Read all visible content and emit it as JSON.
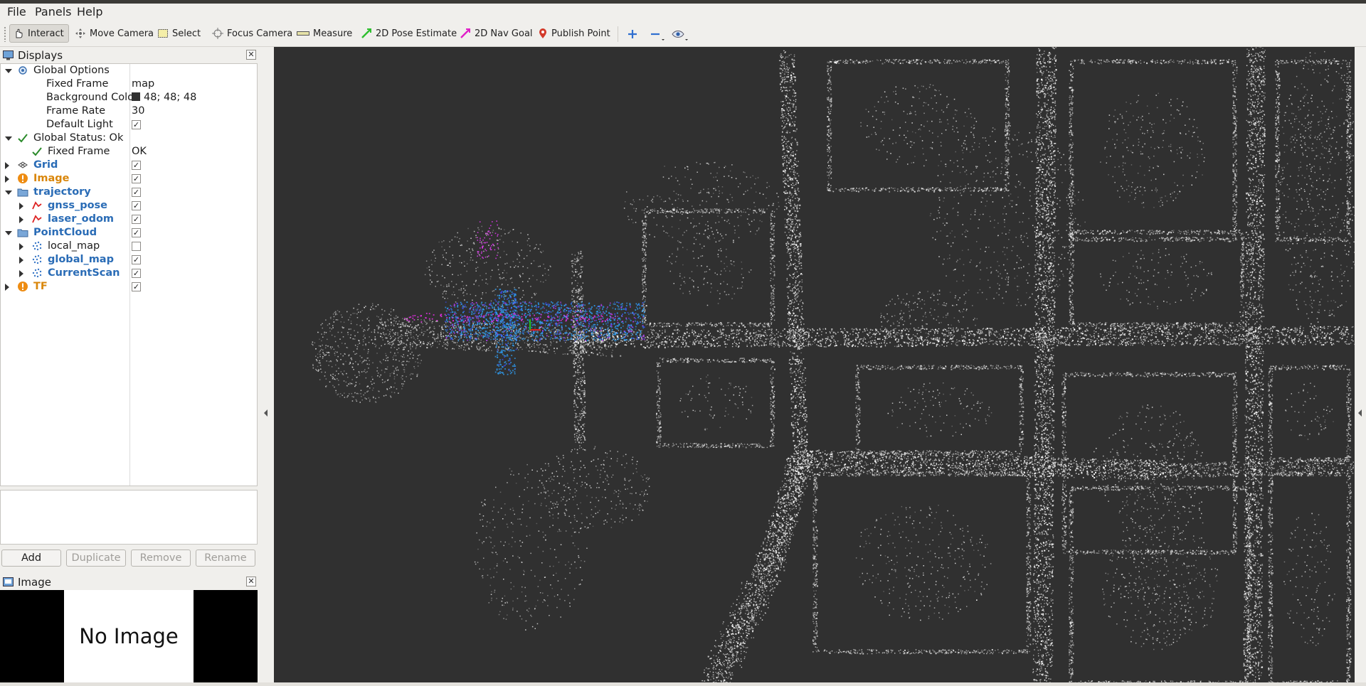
{
  "menu": [
    "File",
    "Panels",
    "Help"
  ],
  "toolbar": {
    "tools": [
      {
        "label": "Interact",
        "icon": "cursor-hand-icon",
        "active": true
      },
      {
        "label": "Move Camera",
        "icon": "move-camera-icon"
      },
      {
        "label": "Select",
        "icon": "select-box-icon"
      },
      {
        "label": "Focus Camera",
        "icon": "focus-camera-icon"
      },
      {
        "label": "Measure",
        "icon": "ruler-icon"
      },
      {
        "label": "2D Pose Estimate",
        "icon": "pose-estimate-arrow-icon",
        "color": "#2fbf2f"
      },
      {
        "label": "2D Nav Goal",
        "icon": "nav-goal-arrow-icon",
        "color": "#e020c8"
      },
      {
        "label": "Publish Point",
        "icon": "map-pin-icon",
        "color": "#d33a2a"
      }
    ],
    "extra_icons": [
      "add-tool-icon",
      "remove-tool-icon",
      "eye-view-icon"
    ]
  },
  "displays_panel": {
    "title": "Displays",
    "tree": [
      {
        "label": "Global Options",
        "arrow": "down",
        "icon": "gear-icon"
      },
      {
        "label": "Fixed Frame",
        "indent": 1,
        "value": "map"
      },
      {
        "label": "Background Color",
        "indent": 1,
        "value": "48; 48; 48",
        "swatch": "#303030"
      },
      {
        "label": "Frame Rate",
        "indent": 1,
        "value": "30"
      },
      {
        "label": "Default Light",
        "indent": 1,
        "checked": true
      },
      {
        "label": "Global Status: Ok",
        "arrow": "down",
        "icon": "check-icon"
      },
      {
        "label": "Fixed Frame",
        "indent": 1,
        "icon": "check-icon",
        "value": "OK"
      },
      {
        "label": "Grid",
        "arrow": "right",
        "icon": "grid-icon",
        "style": "bold",
        "checked": true
      },
      {
        "label": "Image",
        "arrow": "right",
        "icon": "warning-icon",
        "style": "warn",
        "checked": true
      },
      {
        "label": "trajectory",
        "arrow": "down",
        "icon": "folder-icon",
        "style": "bold",
        "checked": true
      },
      {
        "label": "gnss_pose",
        "indent": 1,
        "arrow": "right",
        "icon": "path-icon",
        "style": "bold",
        "checked": true
      },
      {
        "label": "laser_odom",
        "indent": 1,
        "arrow": "right",
        "icon": "path-icon",
        "style": "bold",
        "checked": true
      },
      {
        "label": "PointCloud",
        "arrow": "down",
        "icon": "folder-icon",
        "style": "bold",
        "checked": true
      },
      {
        "label": "local_map",
        "indent": 1,
        "arrow": "right",
        "icon": "pointcloud-icon",
        "checked": false
      },
      {
        "label": "global_map",
        "indent": 1,
        "arrow": "right",
        "icon": "pointcloud-icon",
        "style": "bold",
        "checked": true
      },
      {
        "label": "CurrentScan",
        "indent": 1,
        "arrow": "right",
        "icon": "pointcloud-icon",
        "style": "bold",
        "checked": true
      },
      {
        "label": "TF",
        "arrow": "right",
        "icon": "warning-icon",
        "style": "warn",
        "checked": true
      }
    ],
    "buttons": [
      "Add",
      "Duplicate",
      "Remove",
      "Rename"
    ]
  },
  "image_panel": {
    "title": "Image",
    "placeholder": "No Image"
  },
  "viewport": {
    "background_color": "#303030"
  }
}
